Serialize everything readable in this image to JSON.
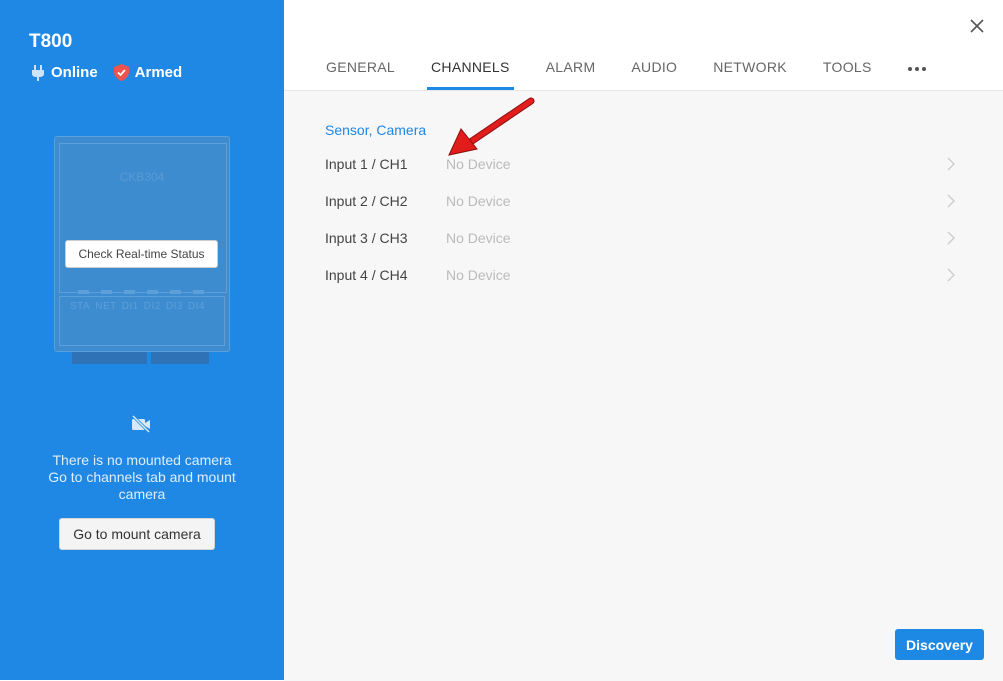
{
  "device": {
    "name": "T800",
    "status_online": "Online",
    "status_armed": "Armed",
    "model": "CKB304",
    "realtime_button": "Check Real-time Status",
    "led_labels": [
      "STA",
      "NET",
      "DI1",
      "DI2",
      "DI3",
      "DI4"
    ]
  },
  "camera_panel": {
    "message": "There is no mounted camera\nGo to channels tab and mount camera",
    "mount_button": "Go to mount camera"
  },
  "tabs": [
    {
      "label": "GENERAL"
    },
    {
      "label": "CHANNELS",
      "active": true
    },
    {
      "label": "ALARM"
    },
    {
      "label": "AUDIO"
    },
    {
      "label": "NETWORK"
    },
    {
      "label": "TOOLS"
    }
  ],
  "channels": {
    "section_title": "Sensor, Camera",
    "rows": [
      {
        "label": "Input 1 / CH1",
        "value": "No Device"
      },
      {
        "label": "Input 2 / CH2",
        "value": "No Device"
      },
      {
        "label": "Input 3 / CH3",
        "value": "No Device"
      },
      {
        "label": "Input 4 / CH4",
        "value": "No Device"
      }
    ]
  },
  "footer": {
    "discovery_button": "Discovery"
  },
  "colors": {
    "accent": "#1e88e5",
    "left_panel": "#1f88e5",
    "armed_icon": "#ef5350",
    "annotation_arrow": "#e21b1b"
  },
  "icons": {
    "online": "plug-icon",
    "armed": "shield-icon",
    "no_camera": "camera-off-icon",
    "close": "close-icon",
    "more": "more-dots-icon",
    "chevron": "chevron-right-icon"
  }
}
